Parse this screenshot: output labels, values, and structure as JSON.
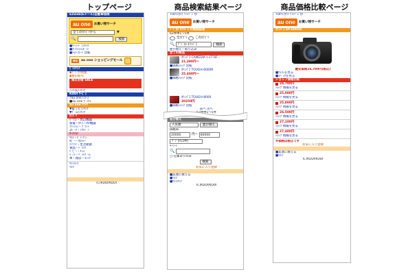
{
  "titles": {
    "top": "トップページ",
    "search": "商品検索結果ページ",
    "compare": "商品価格比較ページ"
  },
  "brand": {
    "logo": "au one",
    "subtitle": "お買い物サーチ",
    "accent_color": "#ef6c00"
  },
  "top_page": {
    "header_line": "EZweb(Eメール)自動車保険",
    "category_select": "全てのｶﾃｺﾞﾘから",
    "search_button": "検索",
    "ad_label": "au one ショッピングモール",
    "sections": [
      "au one ﾚｺｰｽﾞ",
      "au one ﾌﾞｯｸｽ",
      "au one ｸﾘｯｸ",
      "ｶﾃｺﾞﾘ"
    ],
    "footer": "(C)KDDI/KDDI"
  },
  "search_page": {
    "breadcrumb": "TOP>ｶﾃｺﾞﾘ>ﾃﾞｼﾞｶﾒ",
    "result_count": "62件中1〜5件",
    "query": "ﾃﾞｼﾞｶﾒ ｵﾘﾝﾊﾟｽ",
    "search_button": "検索",
    "sort_label": "並び替え",
    "sort_select": "人気順",
    "price_from": "20000",
    "price_to": "80000",
    "maker_select": "ﾃﾞｼﾞｶﾒ(2件)",
    "search_button_bottom": "検索",
    "items": [
      {
        "name": "ｵﾘﾝﾊﾟｽ CAMEDIA ｴｰﾙT RF...",
        "price": "21,380円〜"
      },
      {
        "name": "ｵﾘﾝﾊﾟｽ TOUGH-6000R",
        "price": "25,400円〜"
      },
      {
        "name": "ｵﾘﾝﾊﾟｽ TOUGH-8000",
        "price": "20250円"
      }
    ],
    "footer": "(C)KDDI/KDDI"
  },
  "compare_page": {
    "breadcrumb": "TOP>ｶﾃｺﾞﾘ>ﾃﾞｼﾞｶﾒ",
    "product_name": "ｵﾘﾝﾊﾟｽ SP-600UZ",
    "lowest_price": "最安価格24,780円(税込)",
    "shop_bar": "ショップ価格比較",
    "prices": [
      "24,780円",
      "25,000円",
      "25,800円",
      "26,500円",
      "27,100円",
      "27,400円"
    ],
    "footer": "(C)KDDI/KDDI"
  }
}
